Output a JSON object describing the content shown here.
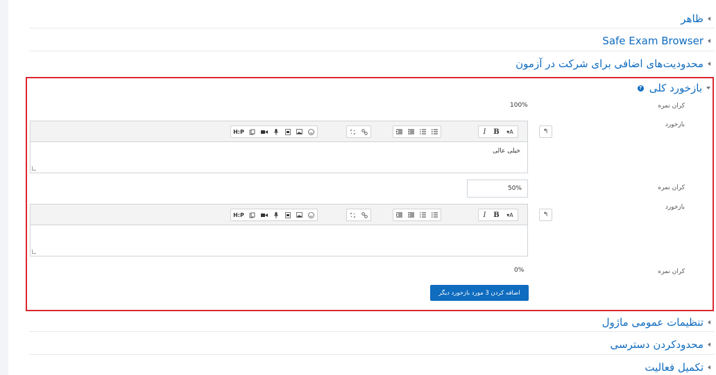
{
  "sections_top": [
    {
      "label": "ظاهر"
    },
    {
      "label": "Safe Exam Browser"
    },
    {
      "label": "محدودیت‌های اضافی برای شرکت در آزمون"
    }
  ],
  "feedback": {
    "title": "بازخورد کلی",
    "help_icon": "help-icon",
    "boundary_label": "کران نمره",
    "feedback_label": "بازخورد",
    "boundary_1": "100%",
    "feedback_1_text": "خیلی عالی",
    "boundary_2_value": "50%",
    "boundary_3": "0%",
    "add_button": "اضافه کردن 3 مورد بازخورد دیگر"
  },
  "toolbar": {
    "undo": "↰",
    "font_color": "▾A",
    "bold": "B",
    "italic": "I",
    "html": "H:P"
  },
  "sections_bottom": [
    {
      "label": "تنظیمات عمومی ماژول"
    },
    {
      "label": "محدودکردن دسترسی"
    },
    {
      "label": "تکمیل فعالیت"
    }
  ],
  "colors": {
    "link": "#0f6cbf",
    "highlight": "#d9272e",
    "button": "#0f6cbf"
  }
}
